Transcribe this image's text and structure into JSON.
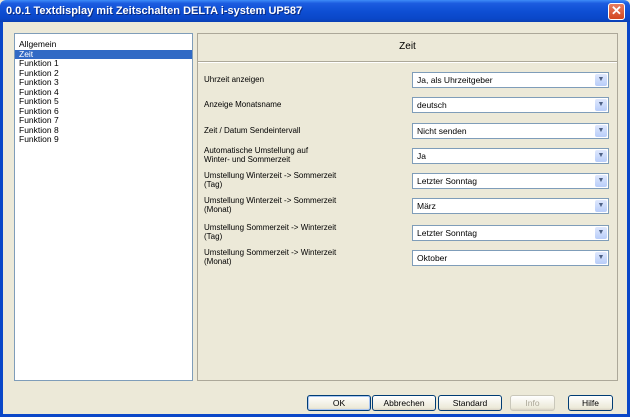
{
  "window": {
    "title": "0.0.1 Textdisplay mit Zeitschalten DELTA i-system UP587"
  },
  "nav": {
    "items": [
      {
        "label": "Allgemein"
      },
      {
        "label": "Zeit"
      },
      {
        "label": "Funktion 1"
      },
      {
        "label": "Funktion 2"
      },
      {
        "label": "Funktion 3"
      },
      {
        "label": "Funktion 4"
      },
      {
        "label": "Funktion 5"
      },
      {
        "label": "Funktion 6"
      },
      {
        "label": "Funktion 7"
      },
      {
        "label": "Funktion 8"
      },
      {
        "label": "Funktion 9"
      }
    ],
    "selected": "Zeit"
  },
  "panel": {
    "title": "Zeit",
    "rows": [
      {
        "label": "Uhrzeit anzeigen",
        "value": "Ja, als Uhrzeitgeber"
      },
      {
        "label": "Anzeige Monatsname",
        "value": "deutsch"
      },
      {
        "label": "Zeit / Datum Sendeintervall",
        "value": "Nicht senden"
      },
      {
        "label": "Automatische Umstellung auf Winter- und Sommerzeit",
        "value": "Ja"
      },
      {
        "label": "Umstellung Winterzeit -> Sommerzeit (Tag)",
        "value": "Letzter Sonntag"
      },
      {
        "label": "Umstellung Winterzeit -> Sommerzeit (Monat)",
        "value": "März"
      },
      {
        "label": "Umstellung Sommerzeit -> Winterzeit (Tag)",
        "value": "Letzter Sonntag"
      },
      {
        "label": "Umstellung Sommerzeit -> Winterzeit (Monat)",
        "value": "Oktober"
      }
    ]
  },
  "buttons": {
    "ok": "OK",
    "cancel": "Abbrechen",
    "standard": "Standard",
    "info": "Info",
    "help": "Hilfe"
  },
  "colors": {
    "titlebar": "#0a47c8",
    "selection": "#316ac5",
    "face": "#ece9d8"
  }
}
